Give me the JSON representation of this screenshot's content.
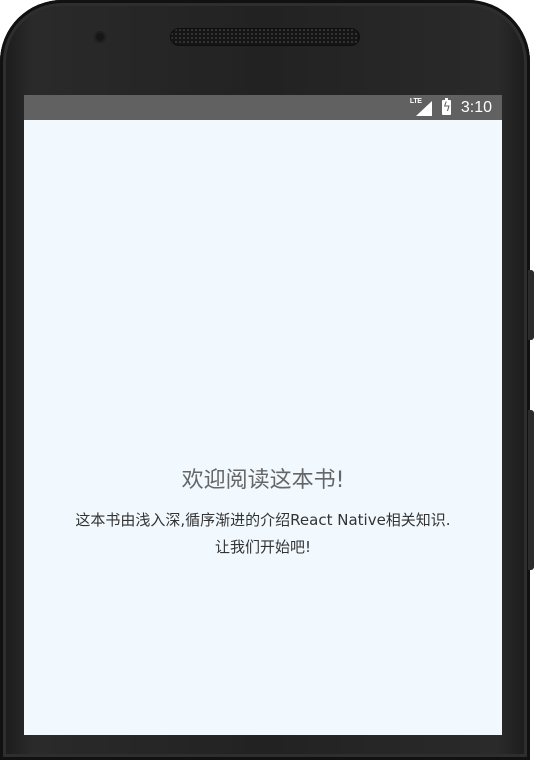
{
  "status_bar": {
    "network_type": "LTE",
    "network_icon": "signal-icon",
    "battery_icon": "battery-charging-icon",
    "time": "3:10"
  },
  "main": {
    "welcome": "欢迎阅读这本书!",
    "intro_line1": "这本书由浅入深,循序渐进的介绍React Native相关知识.",
    "intro_line2": "让我们开始吧!"
  },
  "colors": {
    "screen_background": "#f1f9ff",
    "status_bar": "#616161",
    "welcome_text": "#666666",
    "body_text": "#333333"
  }
}
